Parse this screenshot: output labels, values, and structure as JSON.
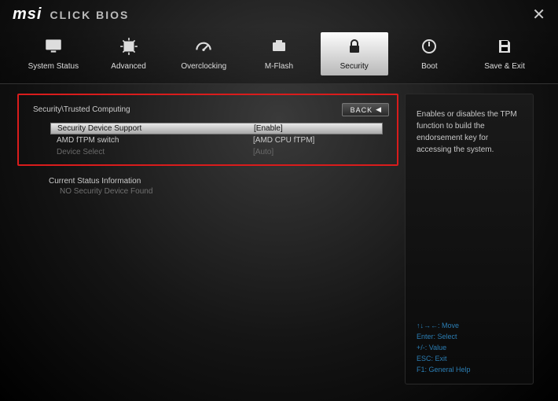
{
  "brand": {
    "logo": "msi",
    "title": "CLICK BIOS"
  },
  "nav": {
    "items": [
      {
        "label": "System Status",
        "icon": "monitor"
      },
      {
        "label": "Advanced",
        "icon": "chip"
      },
      {
        "label": "Overclocking",
        "icon": "gauge"
      },
      {
        "label": "M-Flash",
        "icon": "flash"
      },
      {
        "label": "Security",
        "icon": "lock",
        "selected": true
      },
      {
        "label": "Boot",
        "icon": "power"
      },
      {
        "label": "Save & Exit",
        "icon": "save"
      }
    ]
  },
  "breadcrumb": "Security\\Trusted Computing",
  "back_label": "BACK",
  "settings": [
    {
      "label": "Security Device Support",
      "value": "[Enable]",
      "selected": true
    },
    {
      "label": "AMD fTPM switch",
      "value": "[AMD CPU fTPM]"
    },
    {
      "label": "Device Select",
      "value": "[Auto]",
      "disabled": true
    }
  ],
  "status": {
    "heading": "Current Status Information",
    "line": "NO Security Device Found"
  },
  "help": {
    "text": "Enables or disables the TPM function to build the endorsement key for accessing the system."
  },
  "hints": [
    "↑↓→←: Move",
    "Enter: Select",
    "+/-: Value",
    "ESC: Exit",
    "F1: General Help"
  ]
}
